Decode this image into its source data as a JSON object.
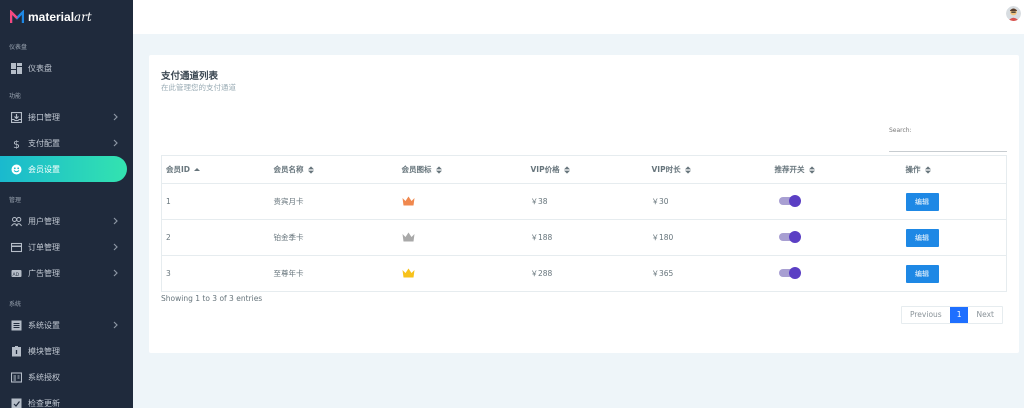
{
  "brand": {
    "name_bold": "material",
    "name_script": "art"
  },
  "sidebar": {
    "sections": [
      {
        "label": "仪表盘",
        "items": [
          {
            "label": "仪表盘",
            "icon": "dashboard-icon",
            "chevron": false
          }
        ]
      },
      {
        "label": "功能",
        "items": [
          {
            "label": "接口管理",
            "icon": "inbox-icon",
            "chevron": true
          },
          {
            "label": "支付配置",
            "icon": "dollar-icon",
            "chevron": true
          },
          {
            "label": "会员设置",
            "icon": "smile-icon",
            "chevron": false,
            "active": true
          }
        ]
      },
      {
        "label": "管理",
        "items": [
          {
            "label": "用户管理",
            "icon": "users-icon",
            "chevron": true
          },
          {
            "label": "订单管理",
            "icon": "card-icon",
            "chevron": true
          },
          {
            "label": "广告管理",
            "icon": "ad-icon",
            "chevron": true
          }
        ]
      },
      {
        "label": "系统",
        "items": [
          {
            "label": "系统设置",
            "icon": "list-icon",
            "chevron": true
          },
          {
            "label": "模块管理",
            "icon": "module-icon",
            "chevron": false
          },
          {
            "label": "系统授权",
            "icon": "auth-icon",
            "chevron": false
          },
          {
            "label": "检查更新",
            "icon": "update-icon",
            "chevron": false
          }
        ]
      }
    ]
  },
  "card": {
    "title": "支付通道列表",
    "subtitle": "在此管理您的支付通道",
    "search_label": "Search:",
    "search_value": ""
  },
  "table": {
    "headers": [
      "会员ID",
      "会员名称",
      "会员图标",
      "VIP价格",
      "VIP时长",
      "推荐开关",
      "操作"
    ],
    "rows": [
      {
        "id": "1",
        "name": "贵宾月卡",
        "crown_color": "#f0884e",
        "price": "￥38",
        "duration": "￥30",
        "recommended": true,
        "action": "编辑"
      },
      {
        "id": "2",
        "name": "铂金季卡",
        "crown_color": "#a9a9a9",
        "price": "￥188",
        "duration": "￥180",
        "recommended": true,
        "action": "编辑"
      },
      {
        "id": "3",
        "name": "至尊年卡",
        "crown_color": "#f7c21b",
        "price": "￥288",
        "duration": "￥365",
        "recommended": true,
        "action": "编辑"
      }
    ]
  },
  "info": "Showing 1 to 3 of 3 entries",
  "pager": {
    "prev": "Previous",
    "current": "1",
    "next": "Next"
  },
  "colors": {
    "sidebar_bg": "#1f2a3c",
    "accent_start": "#1ab9ce",
    "accent_end": "#33e3b0",
    "primary": "#1e88e5",
    "toggle": "#5b3fc4"
  }
}
